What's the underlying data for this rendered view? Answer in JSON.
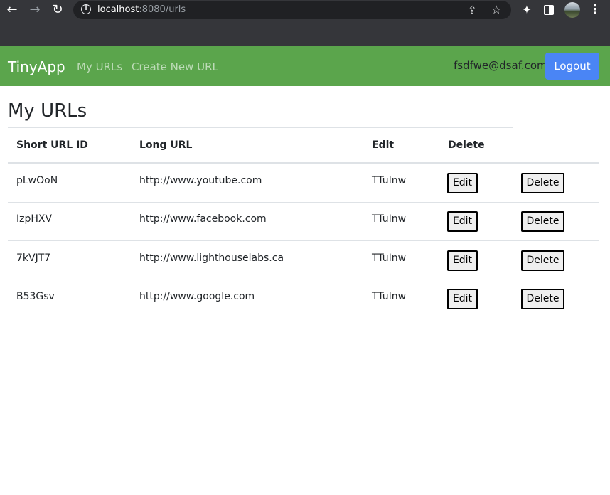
{
  "browser": {
    "url_host": "localhost",
    "url_path": ":8080/urls",
    "icons": [
      "back-arrow-icon",
      "forward-arrow-icon",
      "reload-icon",
      "info-icon",
      "share-icon",
      "star-icon",
      "puzzle-icon",
      "side-panel-icon",
      "avatar",
      "kebab-menu-icon"
    ]
  },
  "navbar": {
    "brand": "TinyApp",
    "links": [
      "My URLs",
      "Create New URL"
    ],
    "user_email": "fsdfwe@dsaf.com",
    "logout_label": "Logout",
    "colors": {
      "bar": "#5ba54c",
      "logout": "#4a85f5"
    }
  },
  "main": {
    "title": "My URLs",
    "columns": [
      "Short URL ID",
      "Long URL",
      "Edit",
      "Delete"
    ],
    "rows": [
      {
        "short_id": "pLwOoN",
        "long_url": "http://www.youtube.com",
        "owner": "TTuInw",
        "edit_label": "Edit",
        "delete_label": "Delete"
      },
      {
        "short_id": "IzpHXV",
        "long_url": "http://www.facebook.com",
        "owner": "TTuInw",
        "edit_label": "Edit",
        "delete_label": "Delete"
      },
      {
        "short_id": "7kVJT7",
        "long_url": "http://www.lighthouselabs.ca",
        "owner": "TTuInw",
        "edit_label": "Edit",
        "delete_label": "Delete"
      },
      {
        "short_id": "B53Gsv",
        "long_url": "http://www.google.com",
        "owner": "TTuInw",
        "edit_label": "Edit",
        "delete_label": "Delete"
      }
    ]
  }
}
